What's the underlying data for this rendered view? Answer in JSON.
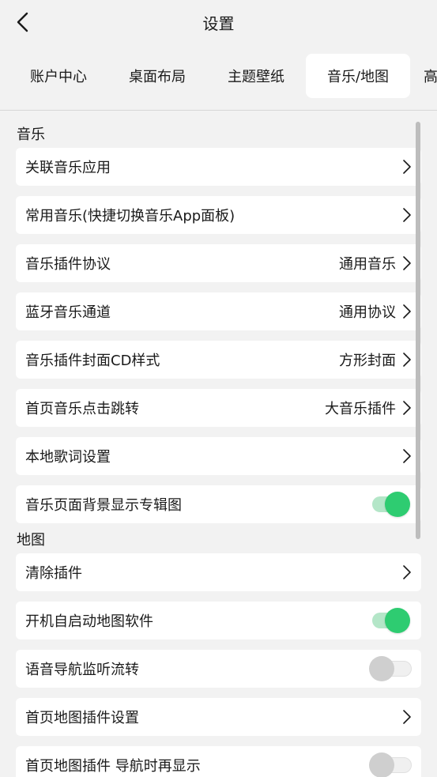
{
  "header": {
    "title": "设置"
  },
  "tabs": [
    {
      "label": "账户中心",
      "active": false
    },
    {
      "label": "桌面布局",
      "active": false
    },
    {
      "label": "主题壁纸",
      "active": false
    },
    {
      "label": "音乐/地图",
      "active": true
    },
    {
      "label": "高",
      "active": false
    }
  ],
  "sections": {
    "music": {
      "title": "音乐"
    },
    "map": {
      "title": "地图"
    }
  },
  "rows": {
    "r0": {
      "label": "关联音乐应用"
    },
    "r1": {
      "label": "常用音乐(快捷切换音乐App面板)"
    },
    "r2": {
      "label": "音乐插件协议",
      "value": "通用音乐"
    },
    "r3": {
      "label": "蓝牙音乐通道",
      "value": "通用协议"
    },
    "r4": {
      "label": "音乐插件封面CD样式",
      "value": "方形封面"
    },
    "r5": {
      "label": "首页音乐点击跳转",
      "value": "大音乐插件"
    },
    "r6": {
      "label": "本地歌词设置"
    },
    "r7": {
      "label": "音乐页面背景显示专辑图",
      "toggle": true
    },
    "r8": {
      "label": "清除插件"
    },
    "r9": {
      "label": "开机自启动地图软件",
      "toggle": true
    },
    "r10": {
      "label": "语音导航监听流转",
      "toggle": false
    },
    "r11": {
      "label": "首页地图插件设置"
    },
    "r12": {
      "label": "首页地图插件 导航时再显示",
      "toggle": false
    }
  },
  "colors": {
    "accent": "#2ecc71",
    "background": "#f2f2f2",
    "card": "#ffffff"
  }
}
